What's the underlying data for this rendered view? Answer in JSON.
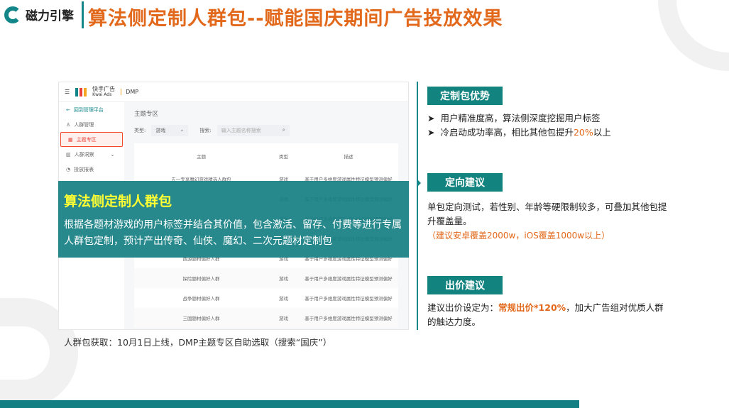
{
  "brand": "磁力引擎",
  "title": "算法侧定制人群包--赋能国庆期间广告投放效果",
  "screenshot": {
    "header": {
      "logo_cn": "快手广告",
      "logo_en": "Kwai Ads",
      "product": "DMP"
    },
    "sidebar": {
      "back": "回到管理平台",
      "items": [
        "人群管理",
        "主题专区",
        "人群洞察",
        "投放报表"
      ]
    },
    "page_title": "主题专区",
    "filter_type_label": "类型:",
    "filter_type_value": "游戏",
    "search_label": "搜索:",
    "search_placeholder": "输入主题名称搜索",
    "columns": [
      "主题",
      "类型",
      "描述"
    ],
    "rows": [
      {
        "name": "五一专享魔幻游戏精选人群包",
        "type": "游戏",
        "desc": "基于用户多维度游戏属性特征模型预测偏好"
      },
      {
        "name": "",
        "type": "游戏",
        "desc": "基于用户多维度游戏属性特征模型预测偏好"
      },
      {
        "name": "",
        "type": "游戏",
        "desc": "基于用户多维度游戏属性特征模型预测偏好"
      },
      {
        "name": "",
        "type": "游戏",
        "desc": "基于用户多维度游戏属性特征模型预测偏好"
      },
      {
        "name": "西游题材偏好人群",
        "type": "游戏",
        "desc": "基于用户多维度游戏属性特征模型预测偏好"
      },
      {
        "name": "探险题材偏好人群",
        "type": "游戏",
        "desc": "基于用户多维度游戏属性特征模型预测偏好"
      },
      {
        "name": "战争题材偏好人群",
        "type": "游戏",
        "desc": "基于用户多维度游戏属性特征模型预测偏好"
      },
      {
        "name": "三国题材偏好人群",
        "type": "游戏",
        "desc": "基于用户多维度游戏属性特征模型预测偏好"
      }
    ]
  },
  "overlay": {
    "heading": "算法侧定制人群包",
    "body": "根据各题材游戏的用户标签并结合其价值，包含激活、留存、付费等进行专属人群包定制，预计产出传奇、仙侠、魔幻、二次元题材定制包"
  },
  "caption": "人群包获取：10月1日上线，DMP主题专区自助选取（搜索“国庆”）",
  "right": {
    "advantage": {
      "label": "定制包优势",
      "b1": "用户精准度高，算法侧深度挖掘用户标签",
      "b2_pre": "冷启动成功率高，相比其他包提升",
      "b2_hl": "20%",
      "b2_post": "以上"
    },
    "targeting": {
      "label": "定向建议",
      "text": "单包定向测试，若性别、年龄等硬限制较多，可叠加其他包提升覆盖量。",
      "note": "（建议安卓覆盖2000w，iOS覆盖1000w以上）"
    },
    "bid": {
      "label": "出价建议",
      "pre": "建议出价设定为：",
      "hl": "常规出价*120%",
      "post": "，加大广告组对优质人群的触达力度。"
    }
  },
  "colors": {
    "teal": "#13868a",
    "orange": "#e2691c",
    "yellow": "#ffff33"
  }
}
